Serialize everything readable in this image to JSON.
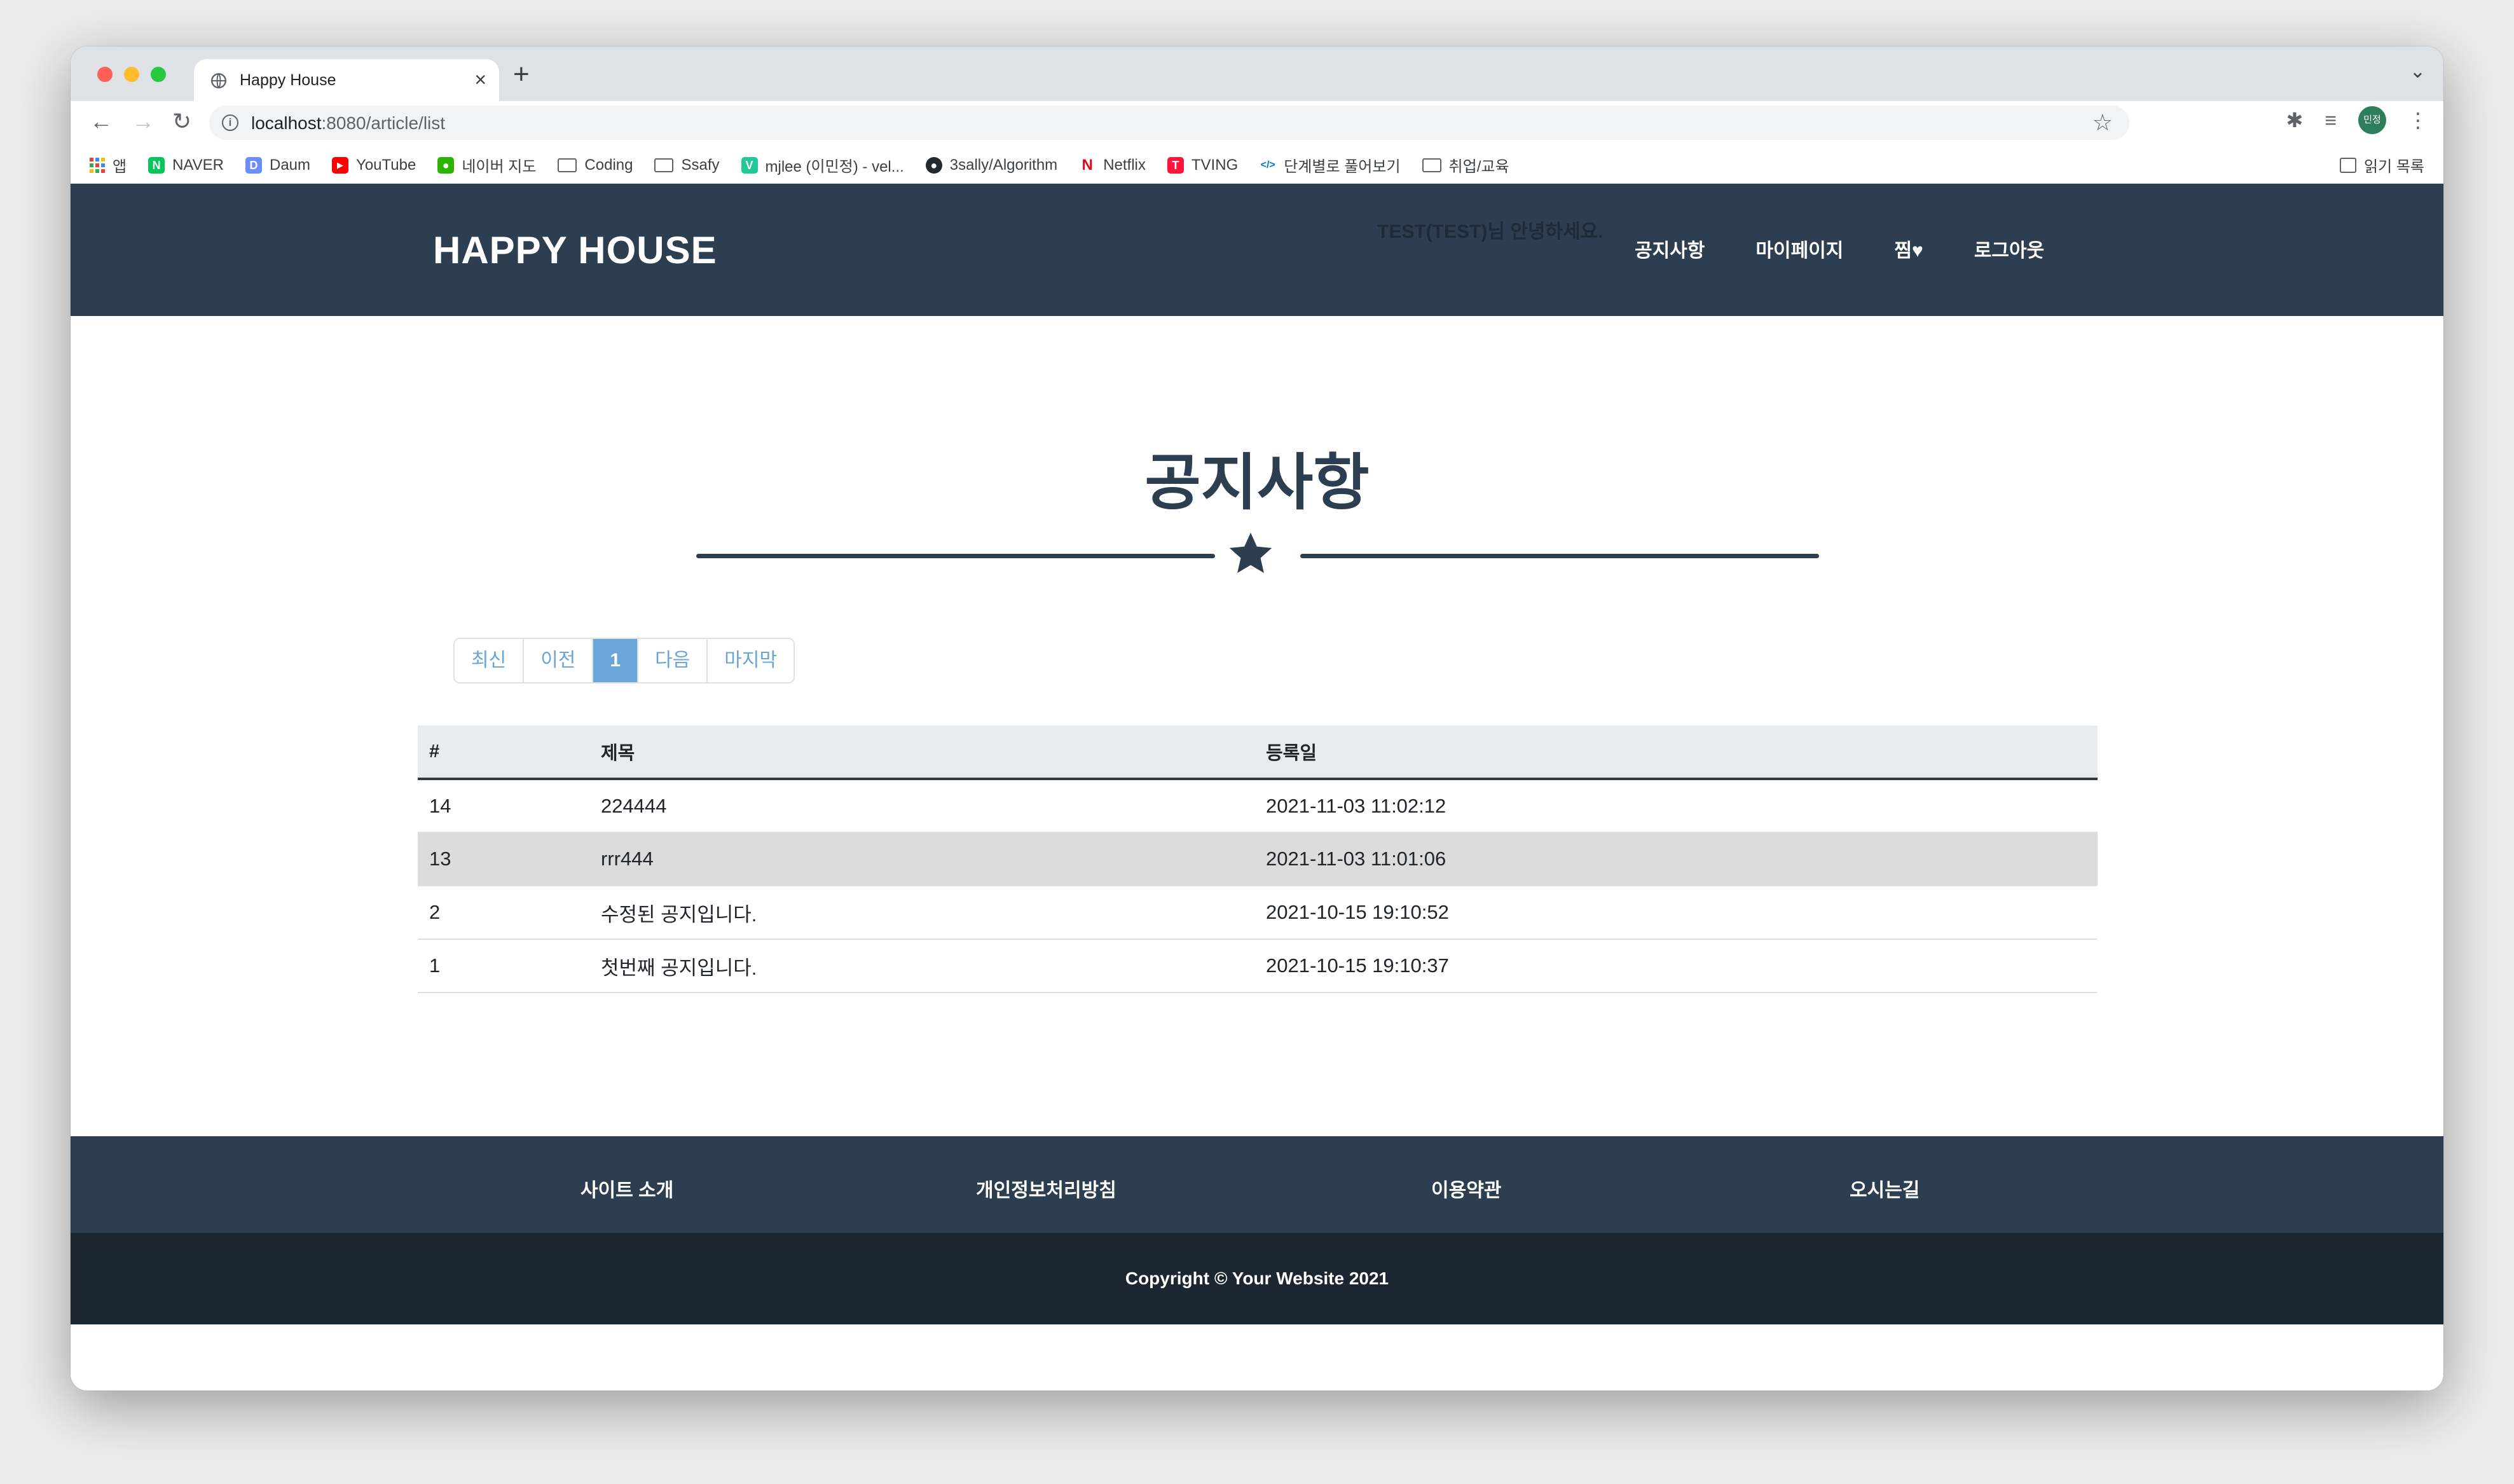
{
  "browser": {
    "tab_title": "Happy House",
    "url_host": "localhost",
    "url_path": ":8080/article/list",
    "bookmarks": [
      {
        "label": "앱"
      },
      {
        "label": "NAVER"
      },
      {
        "label": "Daum"
      },
      {
        "label": "YouTube"
      },
      {
        "label": "네이버 지도"
      },
      {
        "label": "Coding"
      },
      {
        "label": "Ssafy"
      },
      {
        "label": "mjlee (이민정) - vel..."
      },
      {
        "label": "3sally/Algorithm"
      },
      {
        "label": "Netflix"
      },
      {
        "label": "TVING"
      },
      {
        "label": "단계별로 풀어보기"
      },
      {
        "label": "취업/교육"
      }
    ],
    "reading_list": "읽기 목록",
    "profile_initials": "민정"
  },
  "header": {
    "brand": "HAPPY HOUSE",
    "greeting": "TEST(TEST)님 안녕하세요.",
    "nav": [
      "공지사항",
      "마이페이지",
      "찜♥",
      "로그아웃"
    ]
  },
  "main": {
    "title": "공지사항",
    "pager": [
      "최신",
      "이전",
      "1",
      "다음",
      "마지막"
    ],
    "table": {
      "headers": [
        "#",
        "제목",
        "등록일"
      ],
      "rows": [
        [
          "14",
          "224444",
          "2021-11-03 11:02:12"
        ],
        [
          "13",
          "rrr444",
          "2021-11-03 11:01:06"
        ],
        [
          "2",
          "수정된 공지입니다.",
          "2021-10-15 19:10:52"
        ],
        [
          "1",
          "첫번째 공지입니다.",
          "2021-10-15 19:10:37"
        ]
      ]
    }
  },
  "footer": {
    "links": [
      "사이트 소개",
      "개인정보처리방침",
      "이용약관",
      "오시는길"
    ],
    "copyright": "Copyright © Your Website 2021"
  },
  "colors": {
    "header_bg": "#2c3e50",
    "footer_bottom_bg": "#1b2630",
    "accent": "#6aa5d8"
  }
}
